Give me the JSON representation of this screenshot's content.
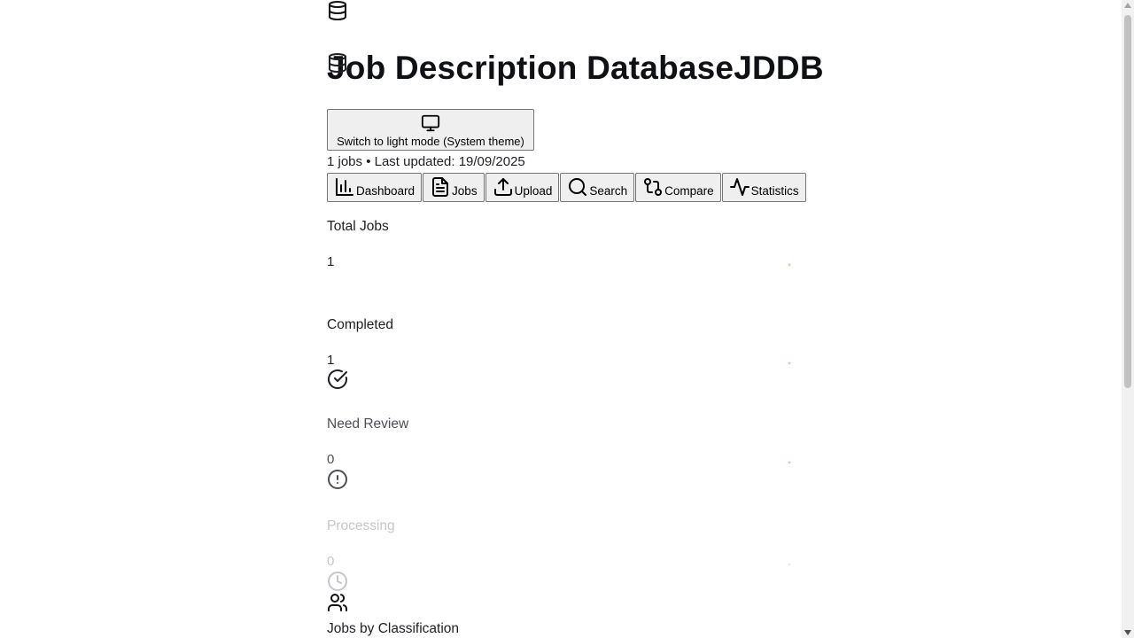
{
  "header": {
    "logo_icon": "database-icon",
    "title": "Job Description DatabaseJDDB"
  },
  "theme_toggle": {
    "icon": "monitor-icon",
    "label": "Switch to light mode (System theme)"
  },
  "meta": {
    "text": "1 jobs • Last updated: 19/09/2025"
  },
  "nav": {
    "items": [
      {
        "label": "Dashboard",
        "icon": "bar-chart-icon"
      },
      {
        "label": "Jobs",
        "icon": "file-text-icon"
      },
      {
        "label": "Upload",
        "icon": "upload-icon"
      },
      {
        "label": "Search",
        "icon": "search-icon"
      },
      {
        "label": "Compare",
        "icon": "git-compare-icon"
      },
      {
        "label": "Statistics",
        "icon": "activity-icon"
      }
    ]
  },
  "stats": [
    {
      "label": "Total Jobs",
      "value": "1",
      "icon": "database-icon",
      "dot": "*"
    },
    {
      "label": "Completed",
      "value": "1",
      "icon": "check-circle-icon",
      "dot": "*"
    },
    {
      "label": "Need Review",
      "value": "0",
      "icon": "alert-circle-icon",
      "dot": "*"
    },
    {
      "label": "Processing",
      "value": "0",
      "icon": "clock-icon",
      "dot": "*"
    }
  ],
  "section": {
    "icon": "users-icon",
    "title": "Jobs by Classification"
  },
  "colors": {
    "text": "#0f1115",
    "button_bg": "#efefef",
    "button_border": "#767676",
    "accent_dot": "#f4a48a",
    "scrollbar_thumb": "#c1c1c1"
  }
}
